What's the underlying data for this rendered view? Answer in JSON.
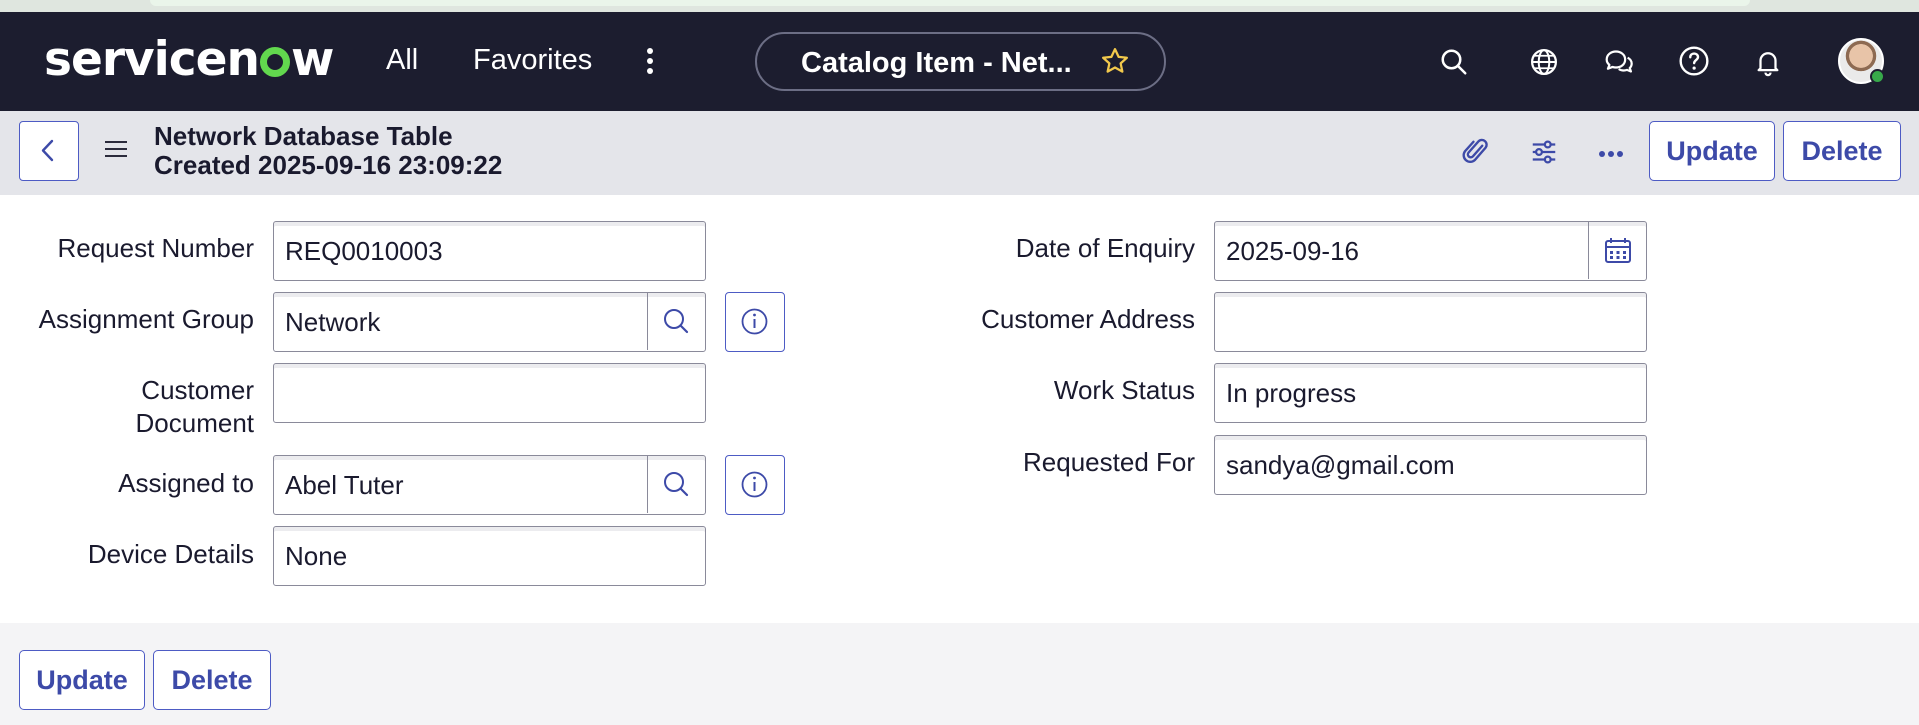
{
  "nav": {
    "logo_left": "servicen",
    "logo_right": "w",
    "all_label": "All",
    "favorites_label": "Favorites",
    "context_title": "Catalog Item - Net...",
    "colors": {
      "nav_bg": "#1c1d2f",
      "accent": "#3d4aa8",
      "logo_green": "#62d84e",
      "star": "#f2c94c"
    },
    "icons": [
      "search-icon",
      "globe-icon",
      "chat-icon",
      "help-icon",
      "bell-icon",
      "avatar"
    ]
  },
  "record": {
    "title": "Network Database Table",
    "created": "Created 2025-09-16 23:09:22",
    "update_label": "Update",
    "delete_label": "Delete"
  },
  "form": {
    "request_number": {
      "label": "Request Number",
      "value": "REQ0010003"
    },
    "assignment_group": {
      "label": "Assignment Group",
      "value": "Network"
    },
    "customer_document": {
      "label_line1": "Customer",
      "label_line2": "Document",
      "value": ""
    },
    "assigned_to": {
      "label": "Assigned to",
      "value": "Abel Tuter"
    },
    "device_details": {
      "label": "Device Details",
      "value": "None"
    },
    "date_of_enquiry": {
      "label": "Date of Enquiry",
      "value": "2025-09-16"
    },
    "customer_address": {
      "label": "Customer Address",
      "value": ""
    },
    "work_status": {
      "label": "Work Status",
      "value": "In progress"
    },
    "requested_for": {
      "label": "Requested For",
      "value": "sandya@gmail.com"
    }
  },
  "footer": {
    "update_label": "Update",
    "delete_label": "Delete"
  }
}
